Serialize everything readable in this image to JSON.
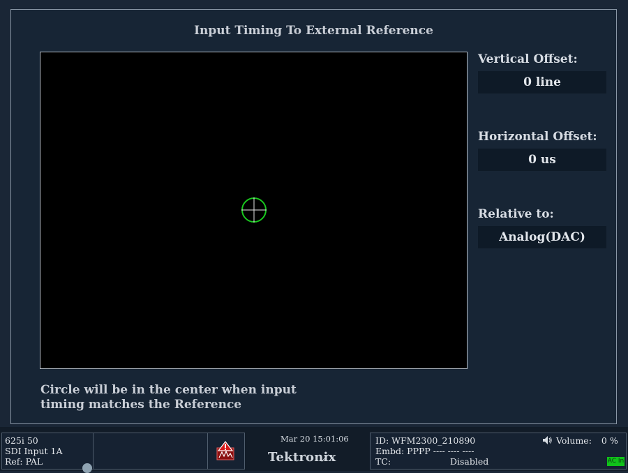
{
  "panel": {
    "title": "Input Timing To External Reference",
    "caption_line1": "Circle will be in the center when input",
    "caption_line2": "timing matches the Reference",
    "vertical_offset_label": "Vertical Offset:",
    "vertical_offset_value": "0 line",
    "horizontal_offset_label": "Horizontal Offset:",
    "horizontal_offset_value": "0 us",
    "relative_to_label": "Relative to:",
    "relative_to_value": "Analog(DAC)"
  },
  "status_bar": {
    "format": "625i 50",
    "input": "SDI Input 1A",
    "ref": "Ref: PAL",
    "datetime": "Mar 20 15:01:06",
    "brand": "Tektronix",
    "id": "ID: WFM2300_210890",
    "embd": "Embd: PPPP ---- ---- ----",
    "tc_label": "TC:",
    "tc_value": "Disabled",
    "volume_label": "Volume:",
    "volume_value": "0 %",
    "ac_badge": "AC In"
  },
  "colors": {
    "background": "#1a2636",
    "target": "#19c81e",
    "ac_badge": "#10c21a"
  },
  "icons": {
    "target": "crosshair-circle-icon",
    "alarm": "alarm-warning-icon",
    "volume": "speaker-icon",
    "ref_status": "status-dot-icon"
  }
}
